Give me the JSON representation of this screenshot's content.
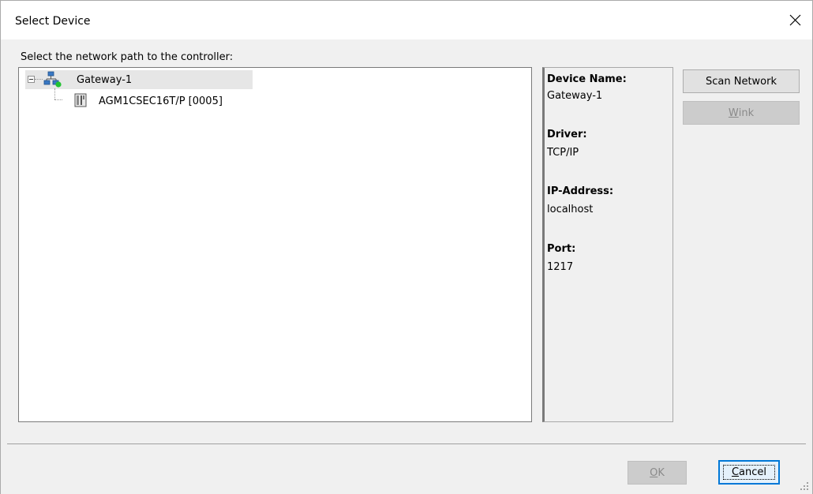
{
  "window": {
    "title": "Select Device",
    "close_icon": "close-icon"
  },
  "tree": {
    "label": "Select the network path to the controller:",
    "items": [
      {
        "label": "Gateway-1",
        "icon": "network-gateway-icon",
        "status_color": "#22c232",
        "expanded": true,
        "selected": true
      },
      {
        "label": "AGM1CSEC16T/P [0005]",
        "icon": "controller-device-icon"
      }
    ]
  },
  "info": {
    "device_name_label": "Device Name:",
    "device_name_value": "Gateway-1",
    "driver_label": "Driver:",
    "driver_value": "TCP/IP",
    "ip_label": "IP-Address:",
    "ip_value": "localhost",
    "port_label": "Port:",
    "port_value": "1217"
  },
  "buttons": {
    "scan_network": "Scan Network",
    "wink_prefix": "",
    "wink_mnemonic": "W",
    "wink_rest": "ink",
    "ok_mnemonic": "O",
    "ok_rest": "K",
    "cancel_mnemonic": "C",
    "cancel_rest": "ancel"
  },
  "colors": {
    "accent": "#0078d7",
    "status_online": "#22c232"
  }
}
